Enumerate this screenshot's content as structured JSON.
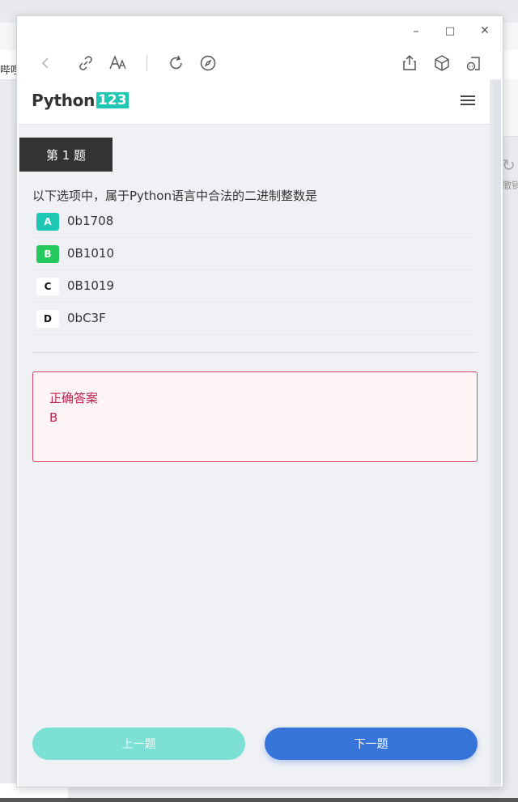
{
  "background": {
    "left_text": "哔哩",
    "right_text": "撤销"
  },
  "window": {
    "controls": {
      "minimize": "–",
      "maximize": "□",
      "close": "✕"
    }
  },
  "toolbar": {
    "icons": [
      "back-icon",
      "link-icon",
      "text-size-icon",
      "refresh-icon",
      "compass-icon",
      "share-icon",
      "cube-icon",
      "reader-icon"
    ]
  },
  "app": {
    "logo_text": "Python",
    "logo_num": "123"
  },
  "question": {
    "tag": "第 1 题",
    "text": "以下选项中，属于Python语言中合法的二进制整数是",
    "options": [
      {
        "letter": "A",
        "text": "0b1708",
        "bg": "#1ec7b3",
        "fg": "#ffffff"
      },
      {
        "letter": "B",
        "text": "0B1010",
        "bg": "#25c95d",
        "fg": "#ffffff"
      },
      {
        "letter": "C",
        "text": "0B1019",
        "bg": "#ffffff",
        "fg": "#111111"
      },
      {
        "letter": "D",
        "text": "0bC3F",
        "bg": "#ffffff",
        "fg": "#111111"
      }
    ]
  },
  "answer": {
    "title": "正确答案",
    "value": "B"
  },
  "nav": {
    "prev_label": "上一题",
    "next_label": "下一题"
  },
  "colors": {
    "accent_teal": "#1ec7b3",
    "accent_green": "#25c95d",
    "answer_red": "#c0204f",
    "next_blue": "#3674d9",
    "prev_teal_light": "#7de0d4"
  }
}
